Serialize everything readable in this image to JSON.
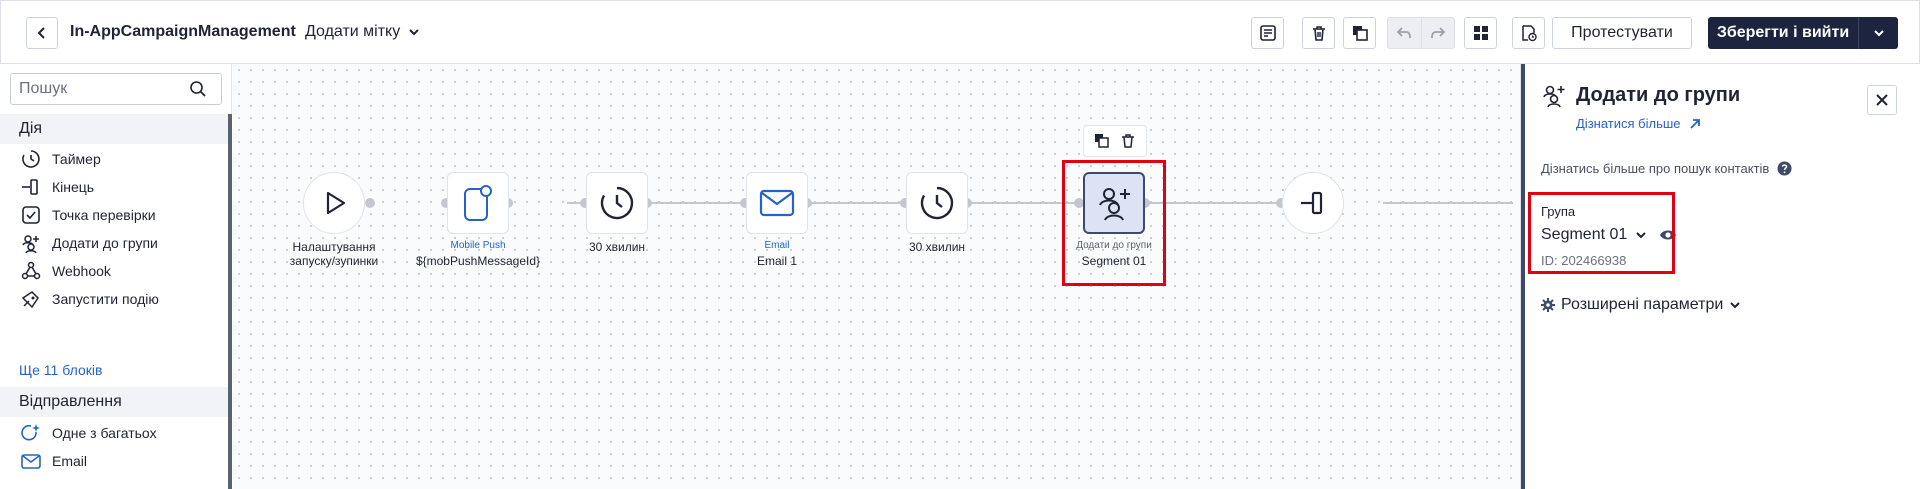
{
  "header": {
    "title": "In-AppCampaignManagement",
    "add_tag_label": "Додати мітку",
    "test_button": "Протестувати",
    "save_button": "Зберегти і вийти"
  },
  "sidebar": {
    "search_placeholder": "Пошук",
    "sections": [
      {
        "title": "Дія",
        "items": [
          {
            "label": "Таймер",
            "icon": "timer-icon"
          },
          {
            "label": "Кінець",
            "icon": "end-icon"
          },
          {
            "label": "Точка перевірки",
            "icon": "checkpoint-icon"
          },
          {
            "label": "Додати до групи",
            "icon": "add-to-group-icon"
          },
          {
            "label": "Webhook",
            "icon": "webhook-icon"
          },
          {
            "label": "Запустити подію",
            "icon": "trigger-event-icon"
          }
        ],
        "more_link": "Ще 11 блоків"
      },
      {
        "title": "Відправлення",
        "items": [
          {
            "label": "Одне з багатьох",
            "icon": "one-of-many-icon"
          },
          {
            "label": "Email",
            "icon": "email-icon"
          }
        ]
      }
    ]
  },
  "canvas": {
    "nodes": [
      {
        "id": "start",
        "type_label": "",
        "label_line1": "Налаштування",
        "label_line2": "запуску/зупинки",
        "icon": "play-icon"
      },
      {
        "id": "push",
        "type_label": "Mobile Push",
        "label_line1": "${mobPushMessageId}",
        "label_line2": "",
        "icon": "mobile-push-icon"
      },
      {
        "id": "timer1",
        "type_label": "",
        "label_line1": "30 хвилин",
        "label_line2": "",
        "icon": "timer-icon"
      },
      {
        "id": "email",
        "type_label": "Email",
        "label_line1": "Email 1",
        "label_line2": "",
        "icon": "email-icon"
      },
      {
        "id": "timer2",
        "type_label": "",
        "label_line1": "30 хвилин",
        "label_line2": "",
        "icon": "timer-icon"
      },
      {
        "id": "group",
        "type_label": "Додати до групи",
        "label_line1": "Segment 01",
        "label_line2": "",
        "icon": "add-to-group-icon",
        "selected": true
      },
      {
        "id": "end",
        "type_label": "",
        "label_line1": "",
        "label_line2": "",
        "icon": "end-icon"
      }
    ]
  },
  "panel": {
    "title": "Додати до групи",
    "learn_more": "Дізнатися більше",
    "contacts_hint": "Дізнатись більше про пошук контактів",
    "group_label": "Група",
    "group_value": "Segment 01",
    "group_id": "ID: 202466938",
    "advanced": "Розширені параметри"
  },
  "colors": {
    "primary_dark": "#1c2440",
    "link_blue": "#2563c9",
    "highlight_red": "#e0000f",
    "selected_node_bg": "#dde3f5"
  }
}
